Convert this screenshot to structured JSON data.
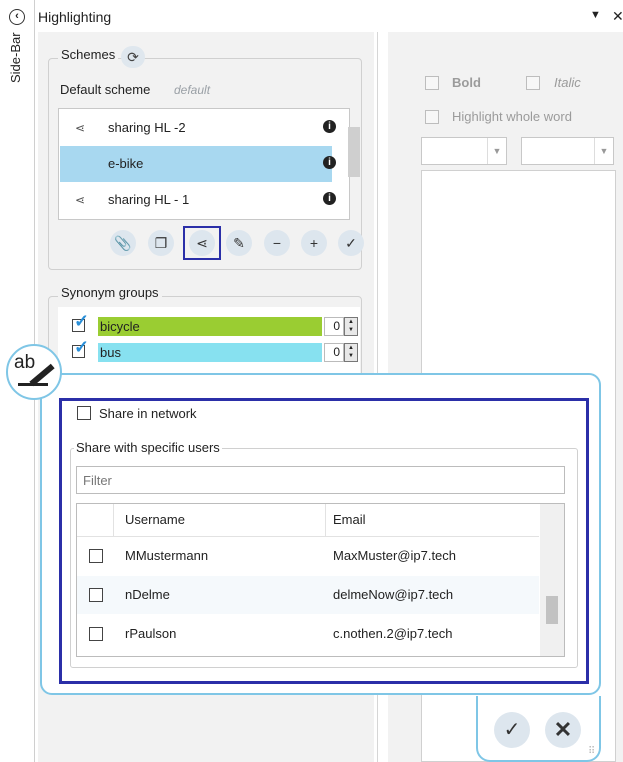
{
  "sidebar": {
    "label": "Side-Bar",
    "collapse_glyph": "‹"
  },
  "window": {
    "title": "Highlighting",
    "pin_glyph": "▼",
    "close_glyph": "✕"
  },
  "schemes": {
    "legend": "Schemes",
    "refresh_glyph": "⟳",
    "default_label": "Default scheme",
    "default_value": "default",
    "items": [
      {
        "label": "sharing HL -2",
        "icon": "share-icon",
        "glyph": "⋖"
      },
      {
        "label": "e-bike",
        "icon": "",
        "glyph": "",
        "selected": true
      },
      {
        "label": "sharing HL - 1",
        "icon": "share-icon",
        "glyph": "⋖"
      }
    ],
    "info_glyph": "i",
    "toolbar": [
      {
        "name": "attach-button",
        "glyph": "📎"
      },
      {
        "name": "copy-button",
        "glyph": "❐"
      },
      {
        "name": "share-button",
        "glyph": "⋖"
      },
      {
        "name": "edit-button",
        "glyph": "✎"
      },
      {
        "name": "remove-button",
        "glyph": "−"
      },
      {
        "name": "add-button",
        "glyph": "+"
      },
      {
        "name": "apply-button",
        "glyph": "✓"
      }
    ]
  },
  "synonyms": {
    "legend": "Synonym groups",
    "items": [
      {
        "label": "bicycle",
        "count": "0",
        "color": "#9acd32"
      },
      {
        "label": "bus",
        "count": "0",
        "color": "#87e1f0"
      }
    ]
  },
  "style_panel": {
    "bold_label": "Bold",
    "italic_label": "Italic",
    "whole_word_label": "Highlight whole word"
  },
  "share_popup": {
    "share_network_label": "Share in network",
    "specific_users_legend": "Share with specific users",
    "filter_placeholder": "Filter",
    "columns": {
      "username": "Username",
      "email": "Email"
    },
    "users": [
      {
        "username": "MMustermann",
        "email": "MaxMuster@ip7.tech"
      },
      {
        "username": "nDelme",
        "email": "delmeNow@ip7.tech"
      },
      {
        "username": "rPaulson",
        "email": "c.nothen.2@ip7.tech"
      }
    ],
    "ok_glyph": "✓",
    "cancel_glyph": "✕"
  },
  "colors": {
    "accent_border": "#2b2fa8",
    "popup_border": "#7fc6e6",
    "selection": "#a8d8f0"
  }
}
